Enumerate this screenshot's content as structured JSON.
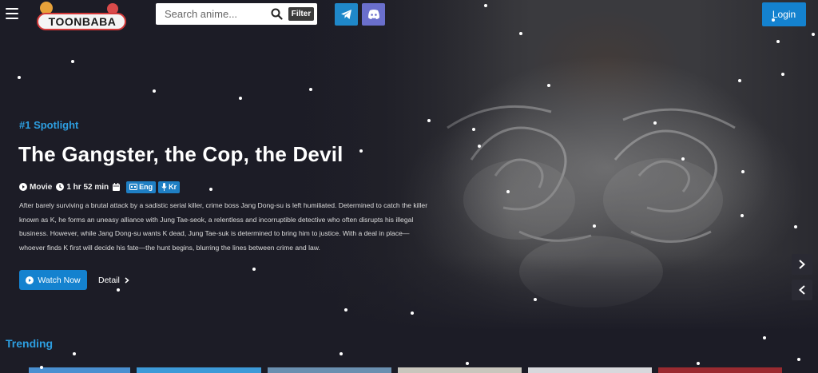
{
  "header": {
    "logo_text": "TOONBABA",
    "search": {
      "placeholder": "Search anime..."
    },
    "filter_label": "Filter",
    "login_label": "Login"
  },
  "icons": [
    "menu-icon",
    "search-icon",
    "telegram-icon",
    "discord-icon",
    "play-circle-icon",
    "clock-icon",
    "calendar-icon",
    "cc-icon",
    "mic-icon",
    "chevron-right-icon",
    "chevron-left-icon"
  ],
  "spotlight": {
    "rank_label": "#1 Spotlight",
    "title": "The Gangster, the Cop, the Devil",
    "type": "Movie",
    "duration": "1 hr 52 min",
    "badges": {
      "sub": "Eng",
      "dub": "Kr"
    },
    "description": "After barely surviving a brutal attack by a sadistic serial killer, crime boss Jang Dong-su is left humiliated. Determined to catch the killer known as K, he forms an uneasy alliance with Jung Tae-seok, a relentless and incorruptible detective who often disrupts his illegal business. However, while Jang Dong-su wants K dead, Jung Tae-suk is determined to bring him to justice. With a deal in place—whoever finds K first will decide his fate—the hunt begins, blurring the lines between crime and law.",
    "watch_label": "Watch Now",
    "detail_label": "Detail"
  },
  "trending": {
    "heading": "Trending"
  },
  "colors": {
    "accent": "#1482cf",
    "accent_text": "#2d9ee0",
    "background": "#1c1c26",
    "telegram": "#1f88c9",
    "discord": "#6a6fcc"
  }
}
